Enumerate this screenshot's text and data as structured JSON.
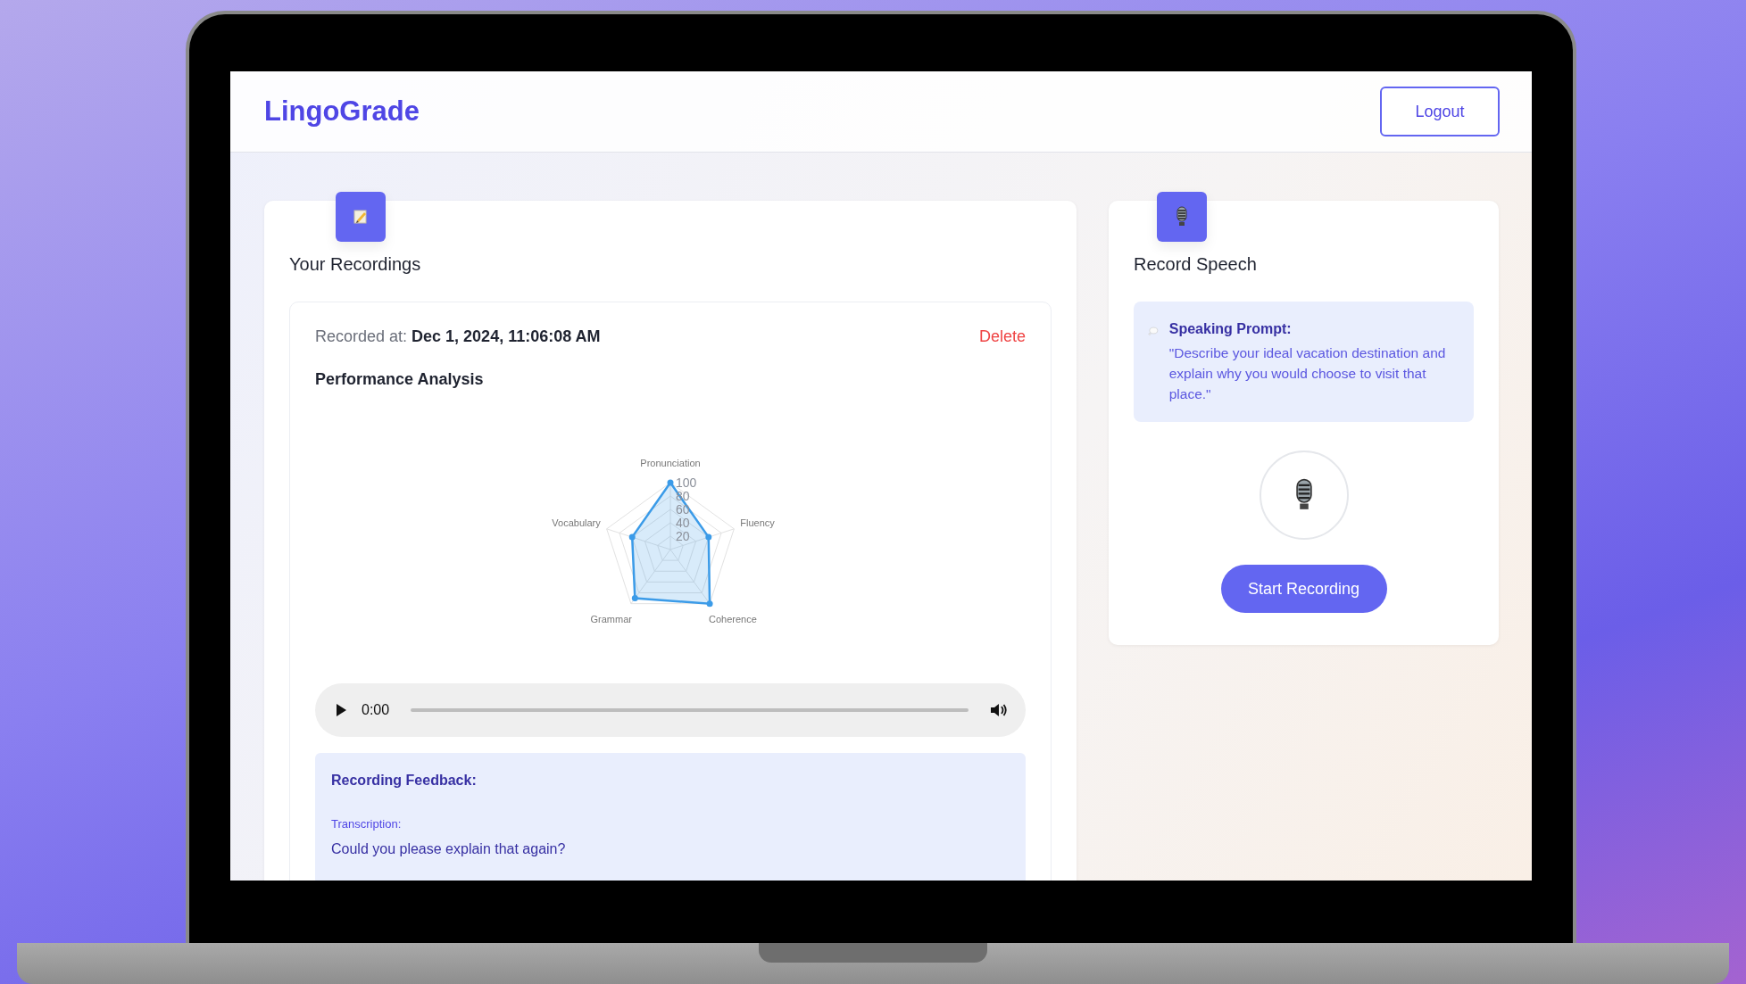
{
  "header": {
    "logo": "LingoGrade",
    "logout": "Logout"
  },
  "recordings": {
    "title": "Your Recordings",
    "item": {
      "recorded_label": "Recorded at:",
      "recorded_value": "Dec 1, 2024, 11:06:08 AM",
      "delete": "Delete",
      "analysis_title": "Performance Analysis",
      "chart_data": {
        "type": "radar",
        "categories": [
          "Pronunciation",
          "Fluency",
          "Coherence",
          "Grammar",
          "Vocabulary"
        ],
        "ylim": [
          0,
          100
        ],
        "yticks": [
          20,
          40,
          60,
          80,
          100
        ],
        "series": [
          {
            "color": "#3b9be8",
            "values": [
              100,
              60,
              100,
              90,
              60
            ]
          }
        ]
      },
      "audio": {
        "time": "0:00"
      },
      "feedback": {
        "title": "Recording Feedback:",
        "transcription_label": "Transcription:",
        "transcription": "Could you please explain that again?"
      }
    }
  },
  "record": {
    "title": "Record Speech",
    "prompt_title": "Speaking Prompt:",
    "prompt_text": "\"Describe your ideal vacation destination and explain why you would choose to visit that place.\"",
    "start": "Start Recording"
  }
}
